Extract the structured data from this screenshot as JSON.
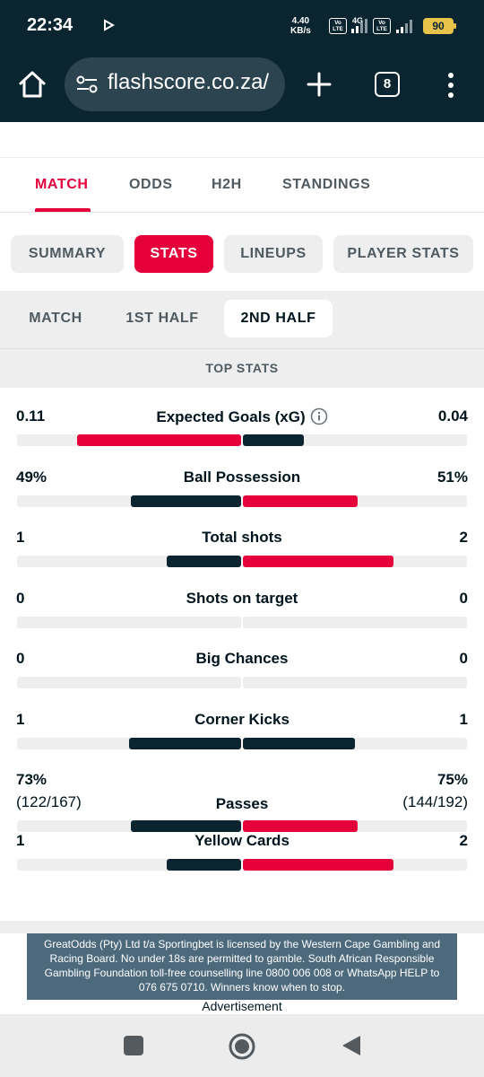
{
  "status_bar": {
    "time": "22:34",
    "net_speed_value": "4.40",
    "net_speed_unit": "KB/s",
    "network_type": "4G",
    "volte_label": "Vo LTE",
    "battery": "90"
  },
  "browser": {
    "url": "flashscore.co.za/",
    "tab_count": "8"
  },
  "main_tabs": [
    {
      "label": "MATCH",
      "active": true
    },
    {
      "label": "ODDS"
    },
    {
      "label": "H2H"
    },
    {
      "label": "STANDINGS"
    }
  ],
  "sub_tabs": [
    {
      "label": "SUMMARY"
    },
    {
      "label": "STATS",
      "active": true
    },
    {
      "label": "LINEUPS"
    },
    {
      "label": "PLAYER STATS"
    }
  ],
  "period_tabs": [
    {
      "label": "MATCH"
    },
    {
      "label": "1ST HALF"
    },
    {
      "label": "2ND HALF",
      "active": true
    }
  ],
  "section_title": "TOP STATS",
  "stats": [
    {
      "label": "Expected Goals (xG)",
      "home": "0.11",
      "away": "0.04",
      "home_frac": 0.73,
      "away_frac": 0.27,
      "leader": "home",
      "info": true
    },
    {
      "label": "Ball Possession",
      "home": "49%",
      "away": "51%",
      "home_frac": 0.49,
      "away_frac": 0.51,
      "leader": "away"
    },
    {
      "label": "Total shots",
      "home": "1",
      "away": "2",
      "home_frac": 0.33,
      "away_frac": 0.67,
      "leader": "away"
    },
    {
      "label": "Shots on target",
      "home": "0",
      "away": "0",
      "home_frac": 0,
      "away_frac": 0,
      "leader": "none"
    },
    {
      "label": "Big Chances",
      "home": "0",
      "away": "0",
      "home_frac": 0,
      "away_frac": 0,
      "leader": "none"
    },
    {
      "label": "Corner Kicks",
      "home": "1",
      "away": "1",
      "home_frac": 0.5,
      "away_frac": 0.5,
      "leader": "none"
    },
    {
      "label": "Passes",
      "home": "73%",
      "away": "75%",
      "home_sub": "(122/167)",
      "away_sub": "(144/192)",
      "home_frac": 0.49,
      "away_frac": 0.51,
      "leader": "away"
    },
    {
      "label": "Yellow Cards",
      "home": "1",
      "away": "2",
      "home_frac": 0.33,
      "away_frac": 0.67,
      "leader": "away"
    }
  ],
  "disclaimer": "GreatOdds (Pty) Ltd t/a Sportingbet is licensed by the Western Cape Gambling and Racing Board. No under 18s are permitted to gamble. South African Responsible Gambling Foundation toll-free counselling line 0800 006 008 or WhatsApp HELP to 076 675 0710. Winners know when to stop.",
  "ad_label": "Advertisement",
  "colors": {
    "accent": "#e5003b",
    "dark": "#0a2530",
    "bar_track": "#eeeeee"
  }
}
